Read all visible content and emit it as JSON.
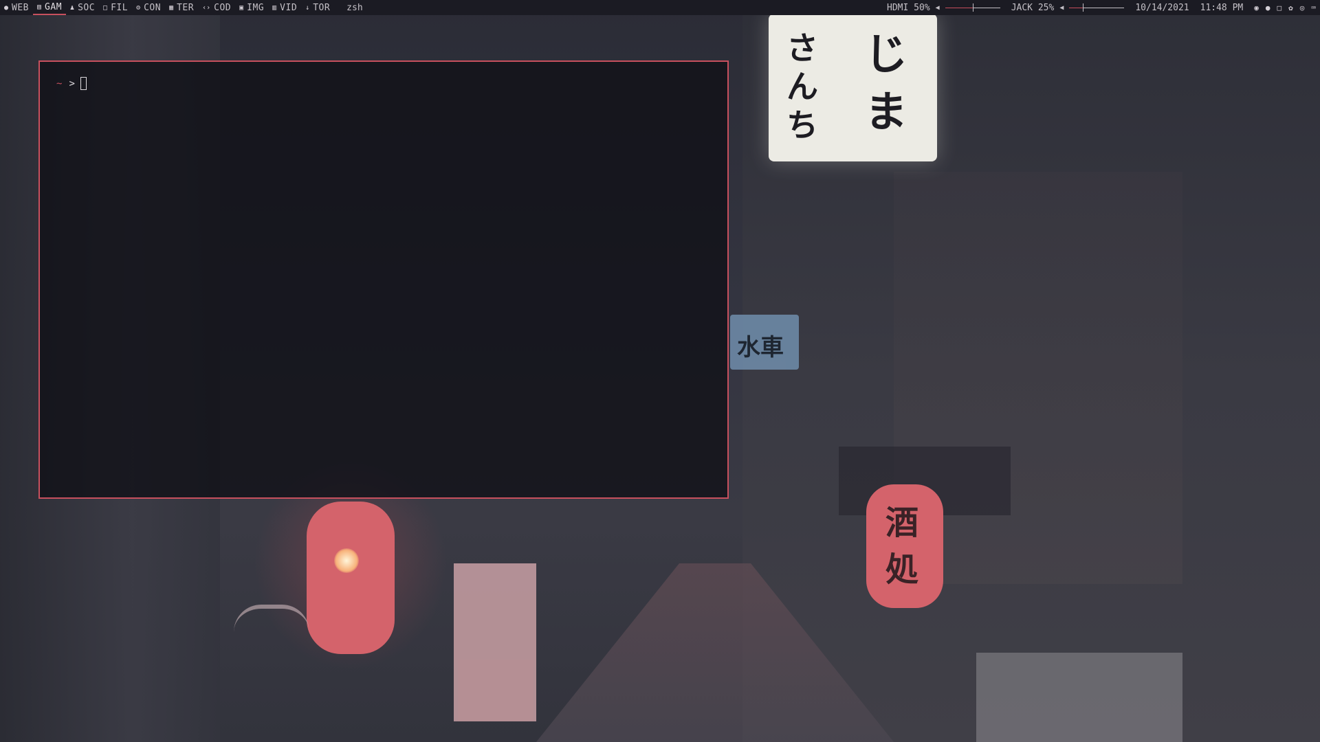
{
  "workspaces": [
    {
      "icon": "globe-icon",
      "label": "WEB",
      "active": false
    },
    {
      "icon": "gamepad-icon",
      "label": "GAM",
      "active": true
    },
    {
      "icon": "users-icon",
      "label": "SOC",
      "active": false
    },
    {
      "icon": "folder-icon",
      "label": "FIL",
      "active": false
    },
    {
      "icon": "gear-icon",
      "label": "CON",
      "active": false
    },
    {
      "icon": "keyboard-icon",
      "label": "TER",
      "active": false
    },
    {
      "icon": "code-icon",
      "label": "COD",
      "active": false
    },
    {
      "icon": "image-icon",
      "label": "IMG",
      "active": false
    },
    {
      "icon": "film-icon",
      "label": "VID",
      "active": false
    },
    {
      "icon": "download-icon",
      "label": "TOR",
      "active": false
    }
  ],
  "window_title": "zsh",
  "audio": [
    {
      "label": "HDMI 50%",
      "level": 0.5,
      "icon": "speaker-icon"
    },
    {
      "label": "JACK 25%",
      "level": 0.25,
      "icon": "speaker-icon"
    }
  ],
  "date": "10/14/2021",
  "time": "11:48 PM",
  "tray": [
    "steam-icon",
    "discord-icon",
    "window-icon",
    "flame-icon",
    "app-icon",
    "keyboard-icon"
  ],
  "terminal": {
    "prompt_dir": "~",
    "prompt_symbol": ">"
  },
  "colors": {
    "accent": "#c8505e",
    "bar_bg": "#1b1b23",
    "text": "#c4c0c6"
  }
}
